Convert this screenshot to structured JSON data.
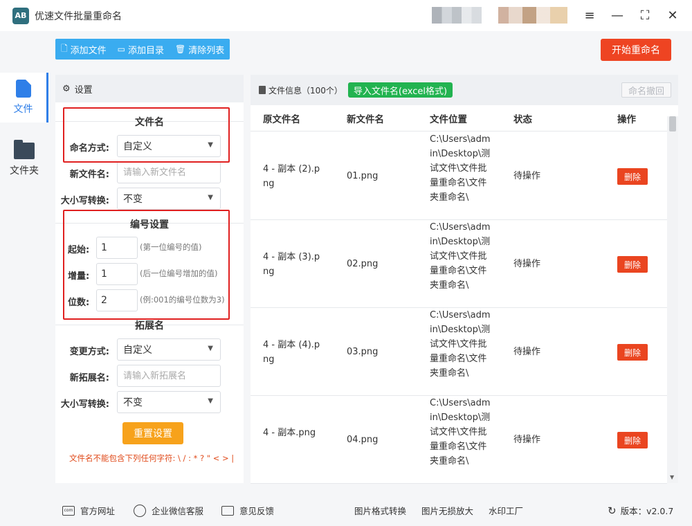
{
  "app": {
    "title": "优速文件批量重命名",
    "logo_text": "AB"
  },
  "window": {
    "menu_icon": "menu-icon",
    "minimize_icon": "minimize-icon",
    "maximize_icon": "maximize-icon",
    "close_icon": "close-icon"
  },
  "nav": [
    {
      "label": "文件",
      "icon": "file-icon",
      "active": true
    },
    {
      "label": "文件夹",
      "icon": "folder-icon",
      "active": false
    }
  ],
  "toolbar": {
    "add_file": "添加文件",
    "add_dir": "添加目录",
    "clear_list": "清除列表",
    "start": "开始重命名"
  },
  "settings": {
    "header": "设置",
    "filename": {
      "title": "文件名",
      "naming_label": "命名方式:",
      "naming_value": "自定义",
      "newname_label": "新文件名:",
      "newname_placeholder": "请输入新文件名",
      "case_label": "大小写转换:",
      "case_value": "不变"
    },
    "numbering": {
      "title": "编号设置",
      "start_label": "起始:",
      "start_value": "1",
      "start_hint": "(第一位编号的值)",
      "step_label": "增量:",
      "step_value": "1",
      "step_hint": "(后一位编号增加的值)",
      "digits_label": "位数:",
      "digits_value": "2",
      "digits_hint": "(例:001的编号位数为3)"
    },
    "extension": {
      "title": "拓展名",
      "mode_label": "变更方式:",
      "mode_value": "自定义",
      "newext_label": "新拓展名:",
      "newext_placeholder": "请输入新拓展名",
      "case_label": "大小写转换:",
      "case_value": "不变"
    },
    "reset": "重置设置",
    "warning": "文件名不能包含下列任何字符: \\ / : * ? \" < > |"
  },
  "files": {
    "info_label": "文件信息（100个）",
    "import_btn": "导入文件名(excel格式)",
    "undo_btn": "命名撤回",
    "columns": [
      "原文件名",
      "新文件名",
      "文件位置",
      "状态",
      "操作"
    ],
    "rows": [
      {
        "orig": "4 - 副本 (2).png",
        "new": "01.png",
        "path": "C:\\Users\\admin\\Desktop\\测试文件\\文件批量重命名\\文件夹重命名\\",
        "status": "待操作",
        "action": "删除"
      },
      {
        "orig": "4 - 副本 (3).png",
        "new": "02.png",
        "path": "C:\\Users\\admin\\Desktop\\测试文件\\文件批量重命名\\文件夹重命名\\",
        "status": "待操作",
        "action": "删除"
      },
      {
        "orig": "4 - 副本 (4).png",
        "new": "03.png",
        "path": "C:\\Users\\admin\\Desktop\\测试文件\\文件批量重命名\\文件夹重命名\\",
        "status": "待操作",
        "action": "删除"
      },
      {
        "orig": "4 - 副本.png",
        "new": "04.png",
        "path": "C:\\Users\\admin\\Desktop\\测试文件\\文件批量重命名\\文件夹重命名\\",
        "status": "待操作",
        "action": "删除"
      }
    ]
  },
  "footer": {
    "website": "官方网址",
    "wechat": "企业微信客服",
    "feedback": "意见反馈",
    "format_convert": "图片格式转换",
    "lossless": "图片无损放大",
    "watermark": "水印工厂",
    "version": "版本：v2.0.7"
  }
}
